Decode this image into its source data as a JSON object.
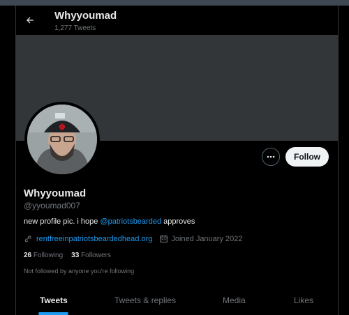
{
  "header": {
    "title": "Whyyoumad",
    "tweet_count": "1,277 Tweets"
  },
  "profile": {
    "name": "Whyyoumad",
    "handle": "@yyoumad007",
    "bio_before": "new profile pic. i hope ",
    "bio_mention": "@patriotsbearded",
    "bio_after": " approves",
    "website": "rentfreeinpatriotsbeardedhead.org",
    "joined": "Joined January 2022",
    "following_count": "26",
    "following_label": "Following",
    "followers_count": "33",
    "followers_label": "Followers",
    "not_followed_note": "Not followed by anyone you’re following"
  },
  "actions": {
    "follow_label": "Follow"
  },
  "tabs": [
    {
      "label": "Tweets",
      "active": true
    },
    {
      "label": "Tweets & replies",
      "active": false
    },
    {
      "label": "Media",
      "active": false
    },
    {
      "label": "Likes",
      "active": false
    }
  ],
  "colors": {
    "accent": "#1d9bf0",
    "banner": "#333639",
    "background": "#000000"
  },
  "icons": [
    "back-arrow-icon",
    "more-icon",
    "link-icon",
    "calendar-icon"
  ]
}
